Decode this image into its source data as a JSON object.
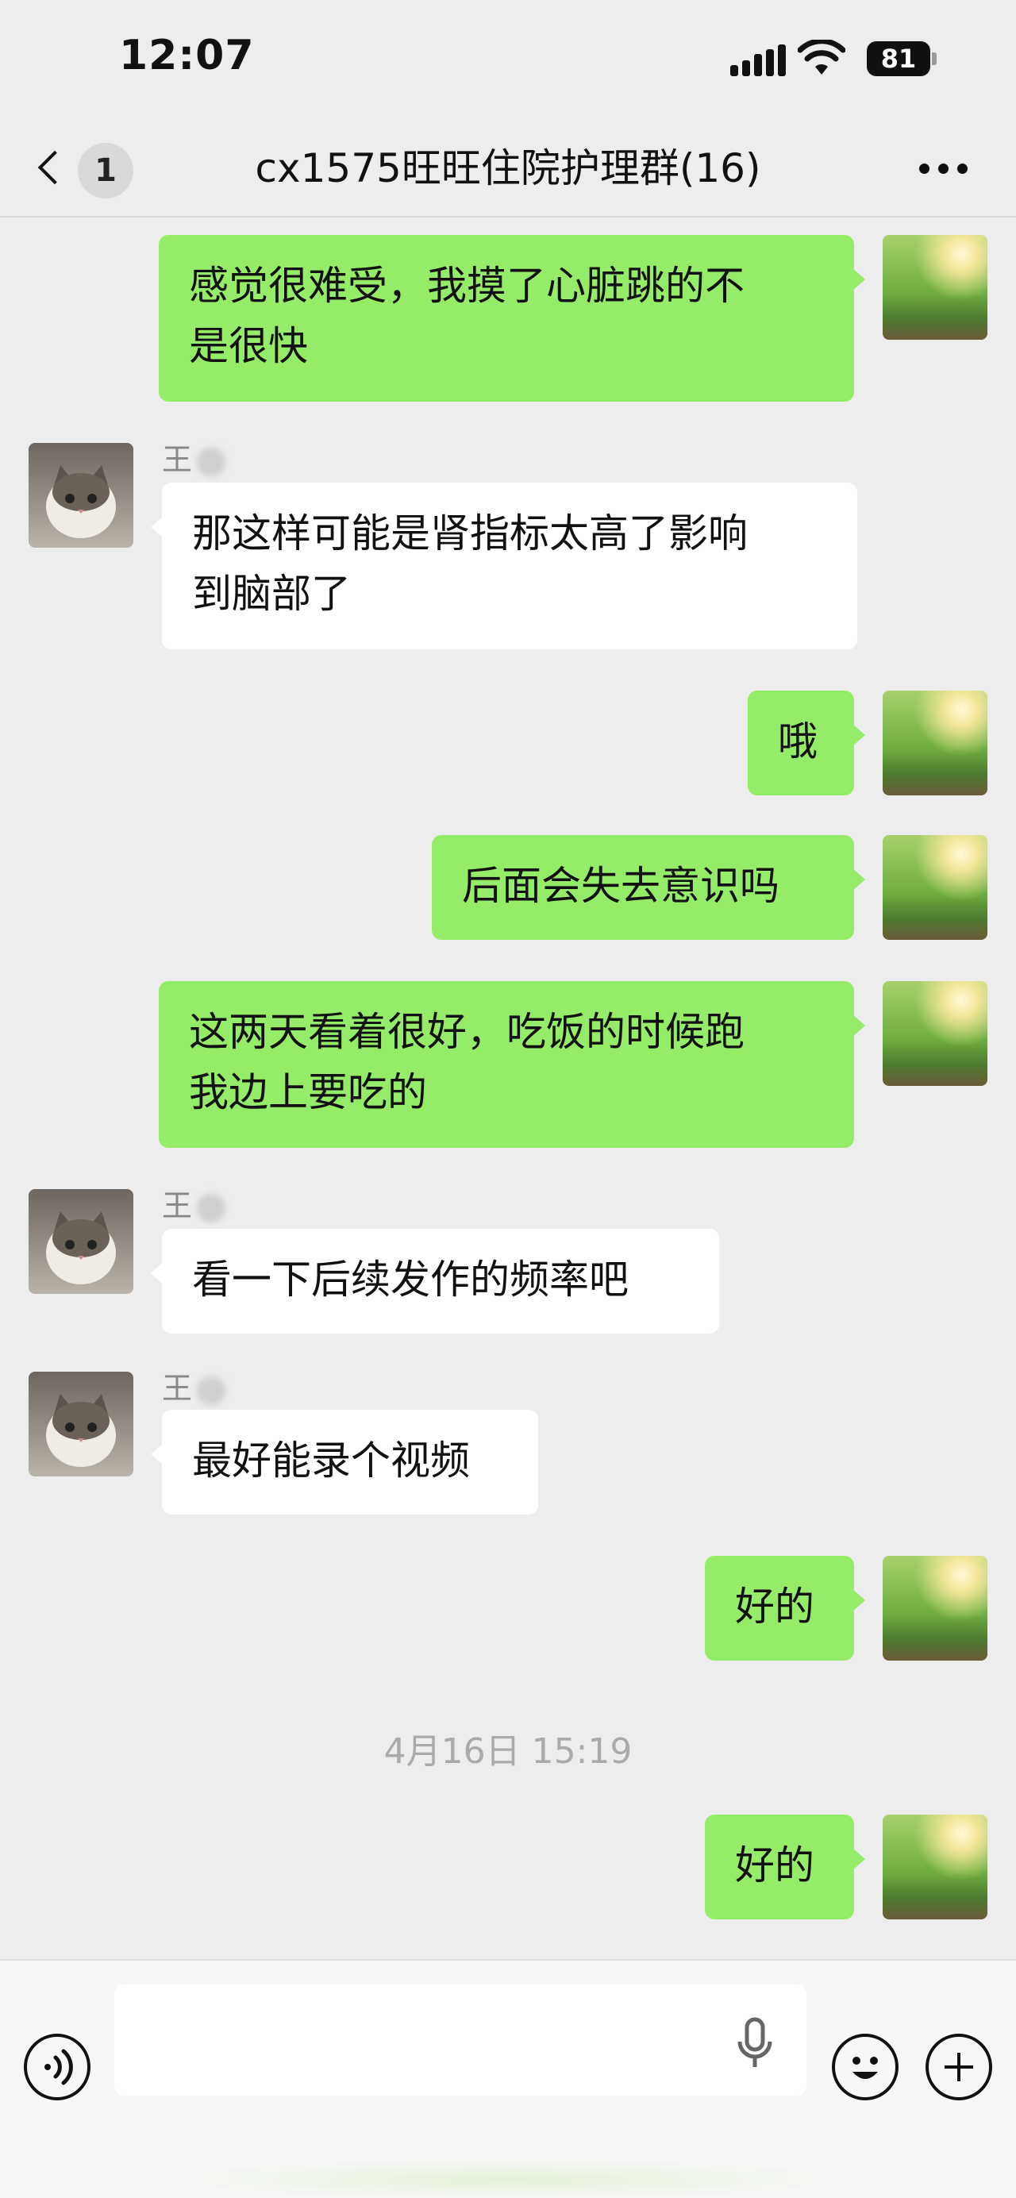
{
  "status_bar": {
    "time": "12:07",
    "battery": "81"
  },
  "nav": {
    "back_badge": "1",
    "title": "cx1575旺旺住院护理群(16)"
  },
  "messages": [
    {
      "side": "out",
      "text_lines": [
        "感觉很难受，我摸了心脏跳的不",
        "是很快"
      ]
    },
    {
      "side": "in",
      "sender": "王",
      "text_lines": [
        "那这样可能是肾指标太高了影响",
        "到脑部了"
      ]
    },
    {
      "side": "out",
      "text_lines": [
        "哦"
      ]
    },
    {
      "side": "out",
      "text_lines": [
        "后面会失去意识吗"
      ]
    },
    {
      "side": "out",
      "text_lines": [
        "这两天看着很好，吃饭的时候跑",
        "我边上要吃的"
      ]
    },
    {
      "side": "in",
      "sender": "王",
      "text_lines": [
        "看一下后续发作的频率吧"
      ]
    },
    {
      "side": "in",
      "sender": "王",
      "text_lines": [
        "最好能录个视频"
      ]
    },
    {
      "side": "out",
      "text_lines": [
        "好的"
      ]
    },
    {
      "side": "out",
      "text_lines": [
        "好的"
      ]
    }
  ],
  "timestamp": "4月16日 15:19",
  "input": {
    "value": ""
  },
  "icons": {
    "back": "chevron-left-icon",
    "more": "more-dots-icon",
    "voice": "voice-icon",
    "mic": "microphone-icon",
    "emoji": "emoji-icon",
    "plus": "plus-icon"
  },
  "colors": {
    "outgoing_bubble": "#95ec69",
    "incoming_bubble": "#ffffff",
    "background": "#ededed"
  }
}
